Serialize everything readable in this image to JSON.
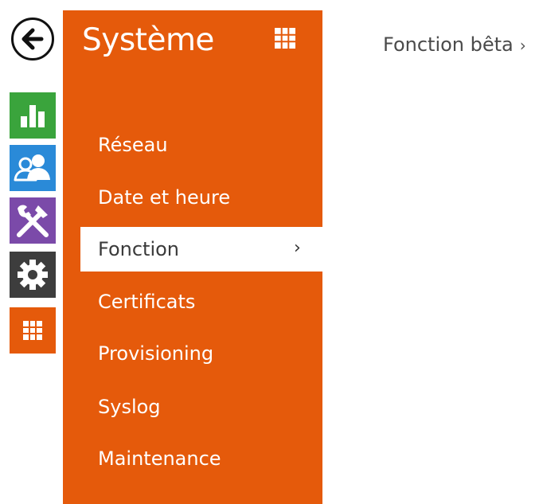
{
  "colors": {
    "panel_orange": "#e55a0b",
    "status_green": "#3aa43c",
    "users_blue": "#2a8ad8",
    "services_purple": "#7b4aa9",
    "hardware_dark": "#3d3d3d",
    "system_orange": "#e55a0b"
  },
  "rail": {
    "back_icon": "arrow-left-icon",
    "items": [
      {
        "icon": "bar-chart-icon",
        "color": "#3aa43c"
      },
      {
        "icon": "users-icon",
        "color": "#2a8ad8"
      },
      {
        "icon": "tools-icon",
        "color": "#7b4aa9"
      },
      {
        "icon": "gear-icon",
        "color": "#3d3d3d"
      },
      {
        "icon": "grid-icon",
        "color": "#e55a0b"
      }
    ]
  },
  "panel": {
    "title": "Système",
    "title_icon": "grid-icon",
    "menu": [
      {
        "label": "Réseau"
      },
      {
        "label": "Date et heure"
      },
      {
        "label": "Fonction",
        "active": true,
        "chevron": "›"
      },
      {
        "label": "Certificats"
      },
      {
        "label": "Provisioning"
      },
      {
        "label": "Syslog"
      },
      {
        "label": "Maintenance"
      }
    ]
  },
  "content": {
    "header": "Fonction bêta",
    "header_chevron": "›"
  }
}
